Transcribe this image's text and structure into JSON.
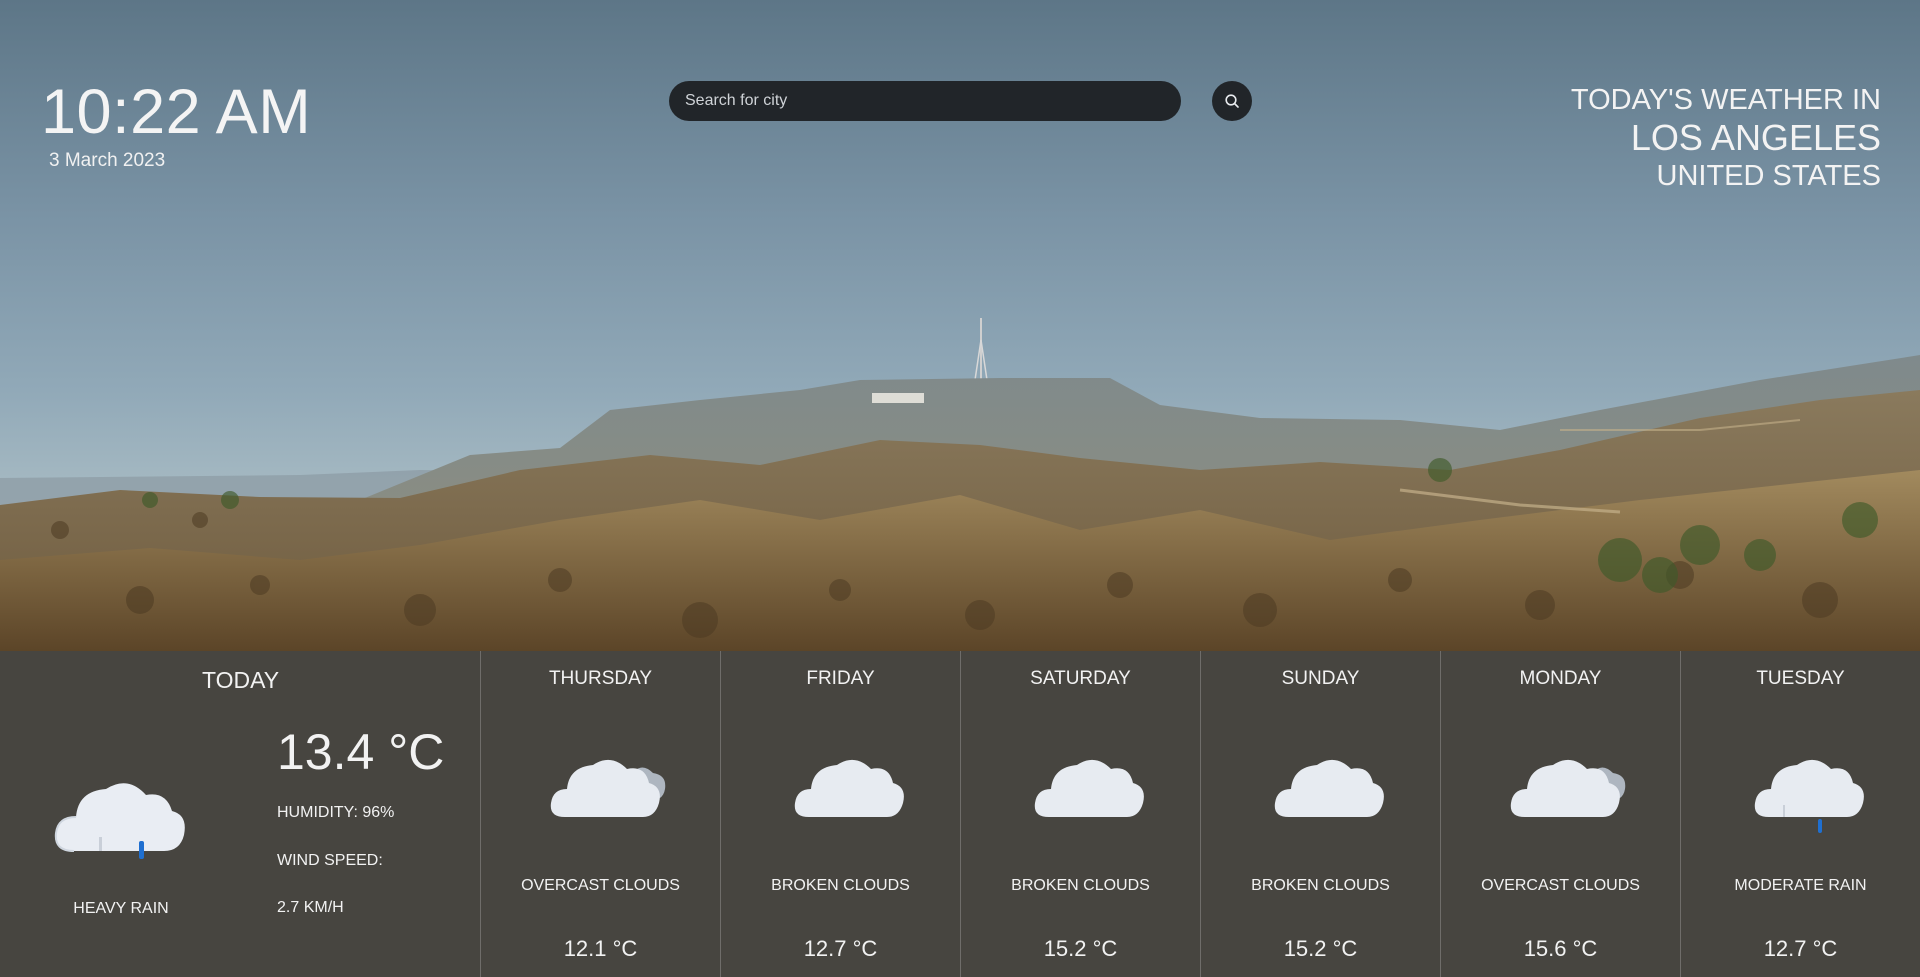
{
  "header": {
    "time": "10:22 AM",
    "date": "3 March 2023",
    "location_line1": "TODAY'S WEATHER IN",
    "location_city": "LOS ANGELES",
    "location_country": "UNITED STATES"
  },
  "search": {
    "placeholder": "Search for city",
    "value": "",
    "button_icon": "search-icon"
  },
  "today": {
    "title": "TODAY",
    "temperature": "13.4 °C",
    "humidity": "HUMIDITY: 96%",
    "wind_label": "WIND SPEED:",
    "wind_value": "2.7 KM/H",
    "description": "HEAVY RAIN",
    "icon": "heavy-rain-cloud-icon"
  },
  "forecast": [
    {
      "day": "THURSDAY",
      "description": "OVERCAST CLOUDS",
      "temp": "12.1 °C",
      "icon": "overcast-clouds-icon"
    },
    {
      "day": "FRIDAY",
      "description": "BROKEN CLOUDS",
      "temp": "12.7 °C",
      "icon": "cloud-icon"
    },
    {
      "day": "SATURDAY",
      "description": "BROKEN CLOUDS",
      "temp": "15.2 °C",
      "icon": "cloud-icon"
    },
    {
      "day": "SUNDAY",
      "description": "BROKEN CLOUDS",
      "temp": "15.2 °C",
      "icon": "cloud-icon"
    },
    {
      "day": "MONDAY",
      "description": "OVERCAST CLOUDS",
      "temp": "15.6 °C",
      "icon": "overcast-clouds-icon"
    },
    {
      "day": "TUESDAY",
      "description": "MODERATE RAIN",
      "temp": "12.7 °C",
      "icon": "moderate-rain-cloud-icon"
    }
  ],
  "colors": {
    "panel": "#1c140c",
    "search_bg": "#212529",
    "rain_drop": "#1f6fd0"
  }
}
